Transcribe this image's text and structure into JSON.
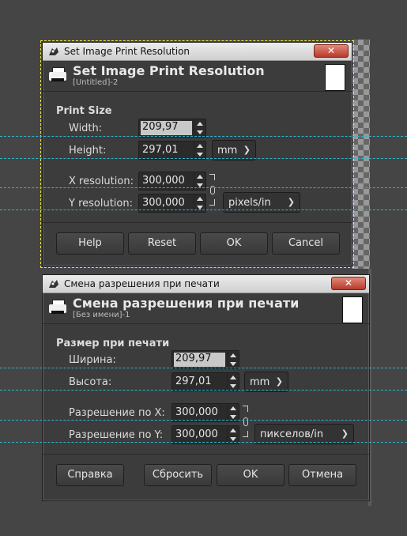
{
  "dialog_en": {
    "window_title": "Set Image Print Resolution",
    "header_title": "Set Image Print Resolution",
    "header_sub": "[Untitled]-2",
    "section": "Print Size",
    "width_label": "Width:",
    "width_value": "209,97",
    "height_label": "Height:",
    "height_value": "297,01",
    "size_unit": "mm",
    "xres_label": "X resolution:",
    "xres_value": "300,000",
    "yres_label": "Y resolution:",
    "yres_value": "300,000",
    "res_unit": "pixels/in",
    "buttons": {
      "help": "Help",
      "reset": "Reset",
      "ok": "OK",
      "cancel": "Cancel"
    }
  },
  "dialog_ru": {
    "window_title": "Смена разрешения при печати",
    "header_title": "Смена разрешения при печати",
    "header_sub": "[Без имени]-1",
    "section": "Размер при печати",
    "width_label": "Ширина:",
    "width_value": "209,97",
    "height_label": "Высота:",
    "height_value": "297,01",
    "size_unit": "mm",
    "xres_label": "Разрешение по X:",
    "xres_value": "300,000",
    "yres_label": "Разрешение по Y:",
    "yres_value": "300,000",
    "res_unit": "пикселов/in",
    "buttons": {
      "help": "Справка",
      "reset": "Сбросить",
      "ok": "OK",
      "cancel": "Отмена"
    }
  },
  "colors": {
    "guide": "#2fb3c9",
    "selection": "#e8e04a",
    "close_button": "#c0473a"
  },
  "icons": [
    "gimp-icon",
    "printer-icon",
    "close-icon",
    "chain-link-icon",
    "chevron-down-icon"
  ]
}
